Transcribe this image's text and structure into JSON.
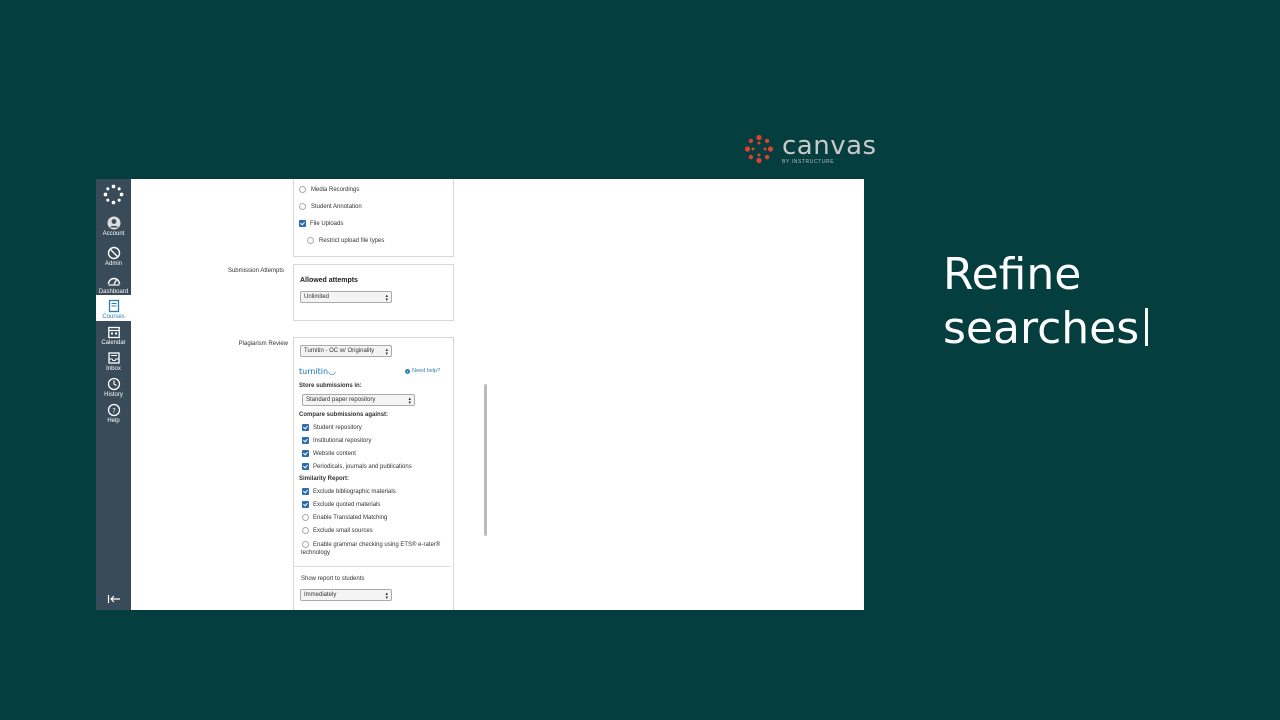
{
  "brand": {
    "word": "canvas",
    "sub": "BY INSTRUCTURE",
    "color": "#e0412f"
  },
  "headline": {
    "line1": "Refine",
    "line2": "searches"
  },
  "nav": {
    "items": [
      {
        "name": "account",
        "label": "Account"
      },
      {
        "name": "admin",
        "label": "Admin"
      },
      {
        "name": "dashboard",
        "label": "Dashboard"
      },
      {
        "name": "courses",
        "label": "Courses"
      },
      {
        "name": "calendar",
        "label": "Calendar"
      },
      {
        "name": "inbox",
        "label": "Inbox"
      },
      {
        "name": "history",
        "label": "History"
      },
      {
        "name": "help",
        "label": "Help"
      }
    ],
    "active": "Courses"
  },
  "entry": {
    "media_recordings": "Media Recordings",
    "student_annotation": "Student Annotation",
    "file_uploads": "File Uploads",
    "restrict_types": "Restrict upload file types"
  },
  "attempts": {
    "label": "Submission Attempts",
    "heading": "Allowed attempts",
    "value": "Unlimited"
  },
  "plagiarism": {
    "label": "Plagiarism Review",
    "tool": "Turnitin - OC w/ Originality",
    "logo": "turnitin",
    "need_help": "Need help?",
    "store_heading": "Store submissions in:",
    "store_value": "Standard paper repository",
    "compare_heading": "Compare submissions against:",
    "compare": [
      "Student repository",
      "Institutional repository",
      "Website content",
      "Periodicals, journals and publications"
    ],
    "similarity_heading": "Similarity Report:",
    "similarity": [
      "Exclude bibliographic materials",
      "Exclude quoted materials",
      "Enable Translated Matching",
      "Exclude small sources"
    ],
    "grammar_line1": "Enable grammar checking using ETS® e-rater®",
    "grammar_line2": "technology",
    "show_report_label": "Show report to students",
    "show_report_value": "Immediately"
  }
}
